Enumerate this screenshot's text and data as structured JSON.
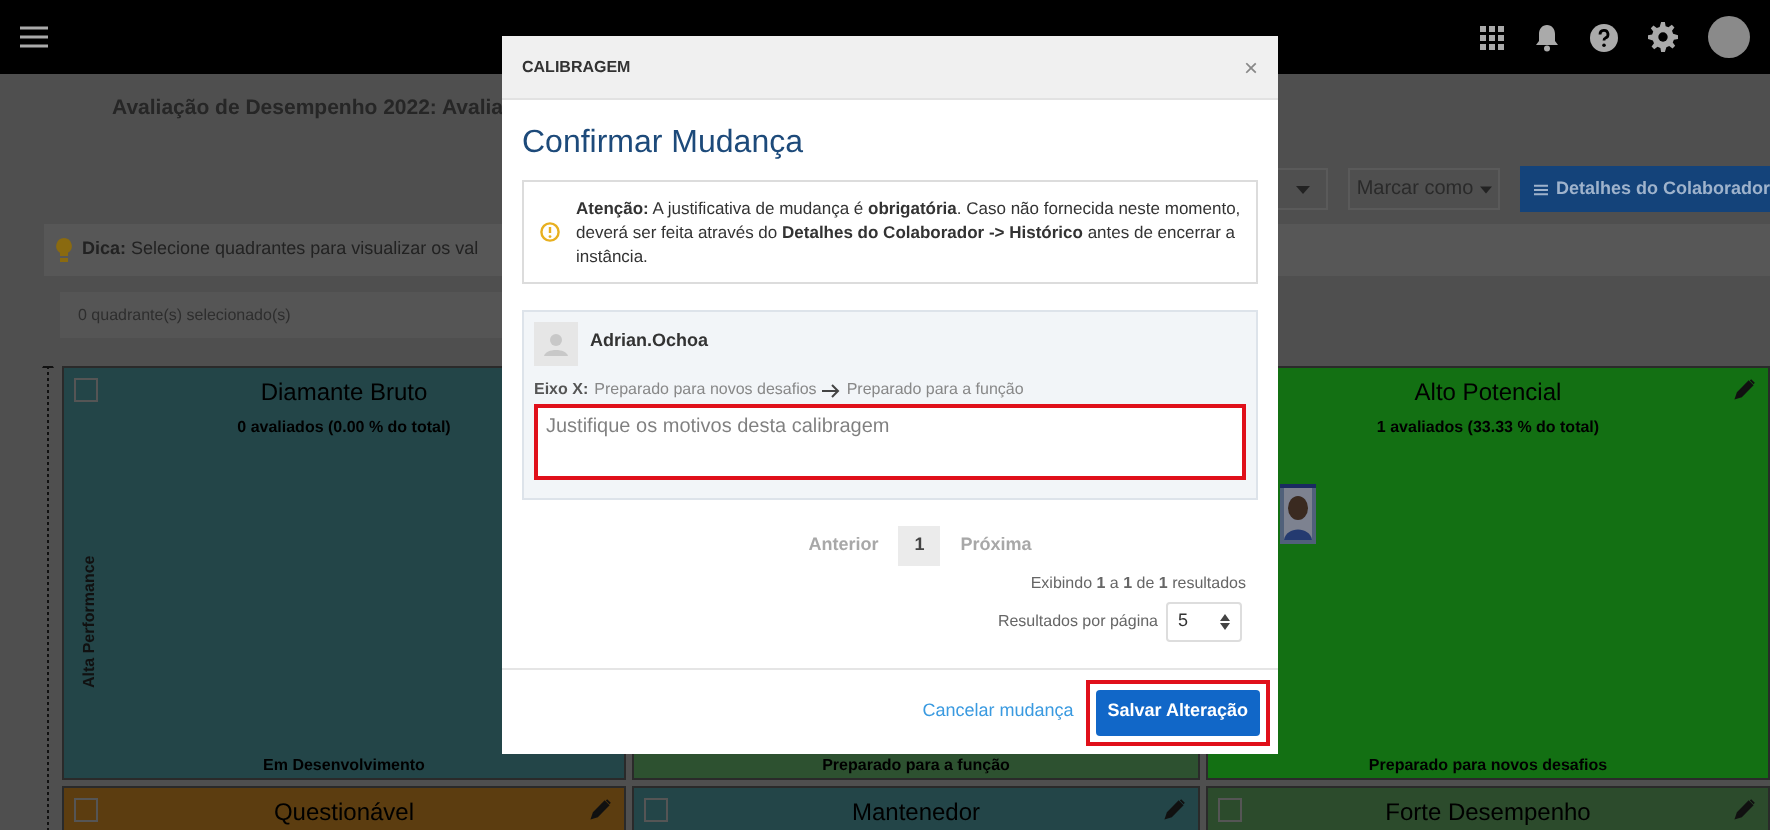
{
  "page": {
    "title": "Avaliação de Desempenho 2022: Avalia",
    "mark_button": "Marcar como",
    "details_button": "Detalhes do Colaborador",
    "tip": "**Dica:** Selecione quadrantes para visualizar os val",
    "selection_count": "0 quadrante(s) selecionado(s)",
    "axis_label": "Alta Performance"
  },
  "quadrants": [
    {
      "title": "Diamante Bruto",
      "count": "0 avaliados (0.00 % do total)",
      "footer": "Em Desenvolvimento",
      "color": "#234548",
      "checked": false,
      "editable": false
    },
    {
      "footer": "Preparado para a função",
      "color": "#2d5130"
    },
    {
      "title": "Alto Potencial",
      "count": "1 avaliados (33.33 % do total)",
      "footer": "Preparado para novos desafios",
      "color": "#137013",
      "editable": true,
      "has_photo": true
    },
    {
      "title": "Questionável",
      "color": "#5c3d10",
      "checked": false,
      "editable": true
    },
    {
      "title": "Mantenedor",
      "color": "#234548",
      "checked": false,
      "editable": true
    },
    {
      "title": "Forte Desempenho",
      "color": "#2c4b2c",
      "checked": false,
      "editable": true
    }
  ],
  "modal": {
    "header": "CALIBRAGEM",
    "close": "×",
    "title": "Confirmar Mudança",
    "alert": "**Atenção:** A justificativa de mudança é **obrigatória**. Caso não fornecida neste momento, deverá ser feita através do **Detalhes do Colaborador -> Histórico** antes de encerrar a instância.",
    "employee": {
      "name": "Adrian.Ochoa",
      "axis_label": "Eixo X:",
      "from": "Preparado para novos desafios",
      "to": "Preparado para a função"
    },
    "justification": {
      "placeholder": "Justifique os motivos desta calibragem",
      "highlighted": true
    },
    "pagination": [
      {
        "label": "Anterior",
        "kind": "link",
        "disabled": true
      },
      {
        "label": "1",
        "kind": "page",
        "selected": true
      },
      {
        "label": "Próxima",
        "kind": "link",
        "disabled": true
      }
    ],
    "results_info": "Exibindo **1** a **1** de **1** resultados",
    "per_page_label": "Resultados por página",
    "per_page_value": "5",
    "cancel": "Cancelar mudança",
    "save": {
      "label": "Salvar Alteração",
      "highlighted": true
    }
  }
}
